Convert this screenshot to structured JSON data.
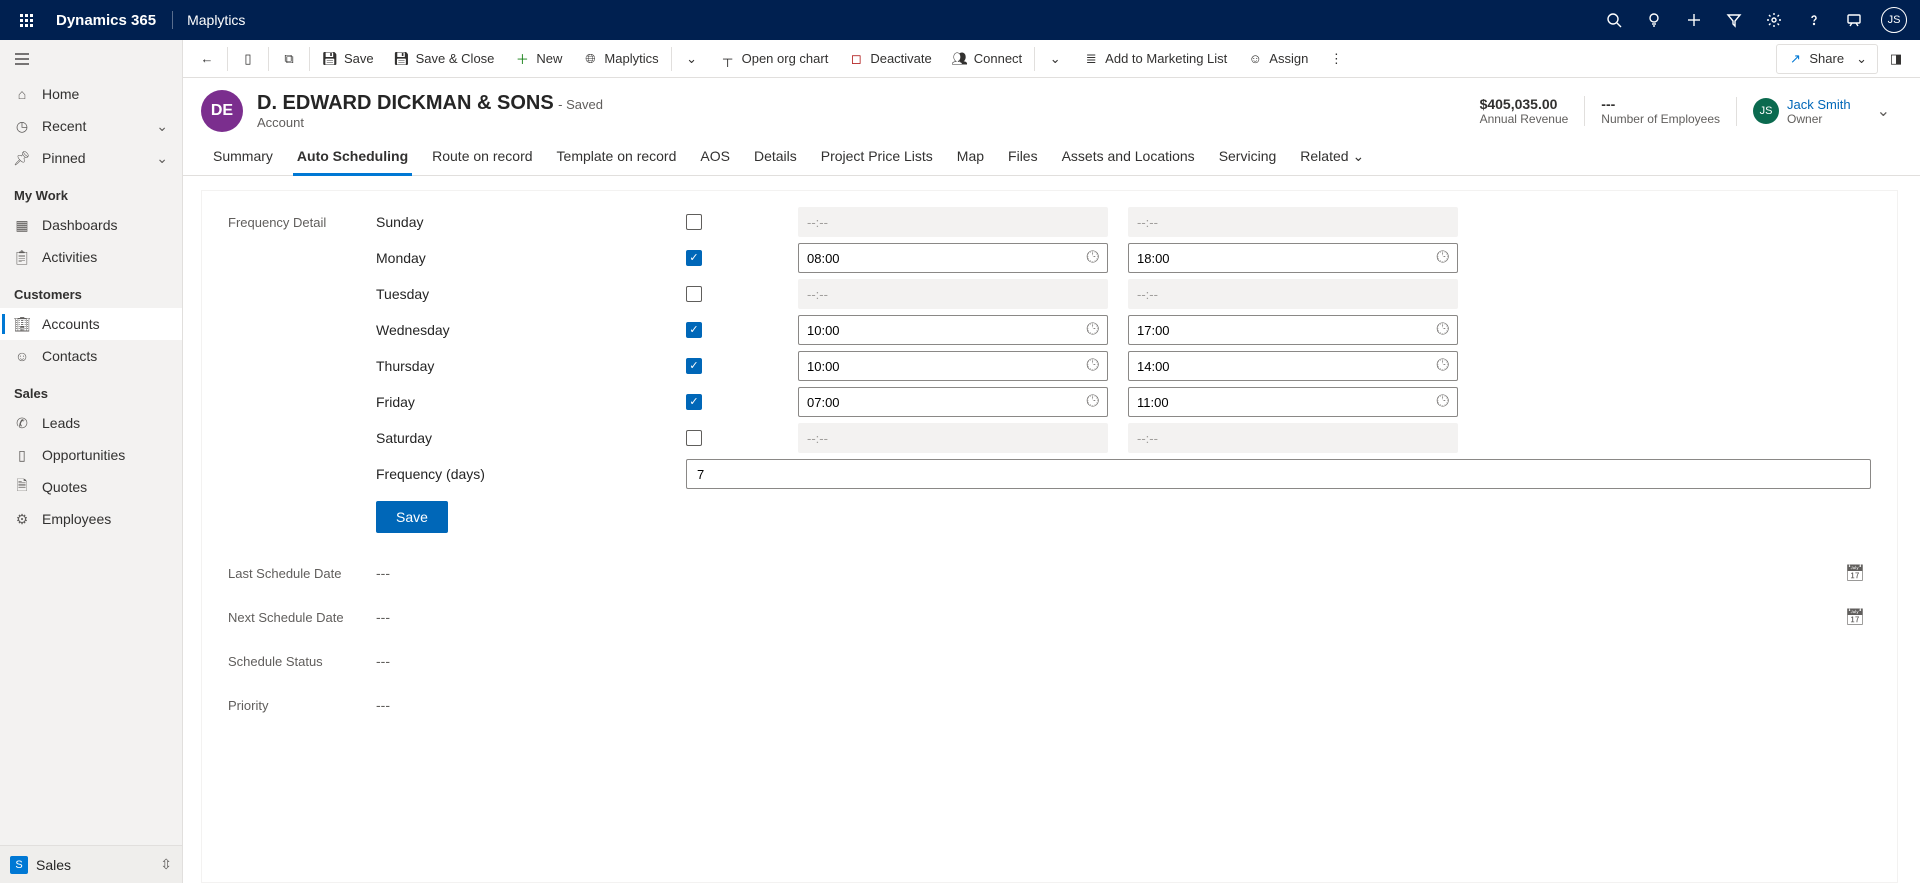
{
  "topbar": {
    "brand": "Dynamics 365",
    "appname": "Maplytics",
    "user_initials": "JS"
  },
  "sidebar": {
    "home": "Home",
    "recent": "Recent",
    "pinned": "Pinned",
    "sections": {
      "mywork": {
        "label": "My Work",
        "dashboards": "Dashboards",
        "activities": "Activities"
      },
      "customers": {
        "label": "Customers",
        "accounts": "Accounts",
        "contacts": "Contacts"
      },
      "sales": {
        "label": "Sales",
        "leads": "Leads",
        "opportunities": "Opportunities",
        "quotes": "Quotes",
        "employees": "Employees"
      }
    },
    "area": {
      "initial": "S",
      "label": "Sales"
    }
  },
  "commands": {
    "save": "Save",
    "saveclose": "Save & Close",
    "new": "New",
    "maplytics": "Maplytics",
    "openorg": "Open org chart",
    "deactivate": "Deactivate",
    "connect": "Connect",
    "addmarketing": "Add to Marketing List",
    "assign": "Assign",
    "share": "Share"
  },
  "record": {
    "badge": "DE",
    "title": "D. EDWARD DICKMAN & SONS",
    "saved_suffix": "- Saved",
    "subtitle": "Account",
    "annual_revenue": {
      "value": "$405,035.00",
      "label": "Annual Revenue"
    },
    "employees": {
      "value": "---",
      "label": "Number of Employees"
    },
    "owner": {
      "initials": "JS",
      "name": "Jack Smith",
      "role": "Owner"
    }
  },
  "tabs": {
    "summary": "Summary",
    "auto": "Auto Scheduling",
    "route": "Route on record",
    "template": "Template on record",
    "aos": "AOS",
    "details": "Details",
    "ppl": "Project Price Lists",
    "map": "Map",
    "files": "Files",
    "assets": "Assets and Locations",
    "servicing": "Servicing",
    "related": "Related"
  },
  "form": {
    "section_label": "Frequency Detail",
    "days": [
      {
        "name": "Sunday",
        "enabled": false,
        "start": "--:--",
        "end": "--:--"
      },
      {
        "name": "Monday",
        "enabled": true,
        "start": "08:00",
        "end": "18:00"
      },
      {
        "name": "Tuesday",
        "enabled": false,
        "start": "--:--",
        "end": "--:--"
      },
      {
        "name": "Wednesday",
        "enabled": true,
        "start": "10:00",
        "end": "17:00"
      },
      {
        "name": "Thursday",
        "enabled": true,
        "start": "10:00",
        "end": "14:00"
      },
      {
        "name": "Friday",
        "enabled": true,
        "start": "07:00",
        "end": "11:00"
      },
      {
        "name": "Saturday",
        "enabled": false,
        "start": "--:--",
        "end": "--:--"
      }
    ],
    "frequency_label": "Frequency (days)",
    "frequency_value": "7",
    "save_btn": "Save",
    "readonly": [
      {
        "label": "Last Schedule Date",
        "value": "---",
        "icon": true
      },
      {
        "label": "Next Schedule Date",
        "value": "---",
        "icon": true
      },
      {
        "label": "Schedule Status",
        "value": "---",
        "icon": false
      },
      {
        "label": "Priority",
        "value": "---",
        "icon": false
      }
    ]
  }
}
